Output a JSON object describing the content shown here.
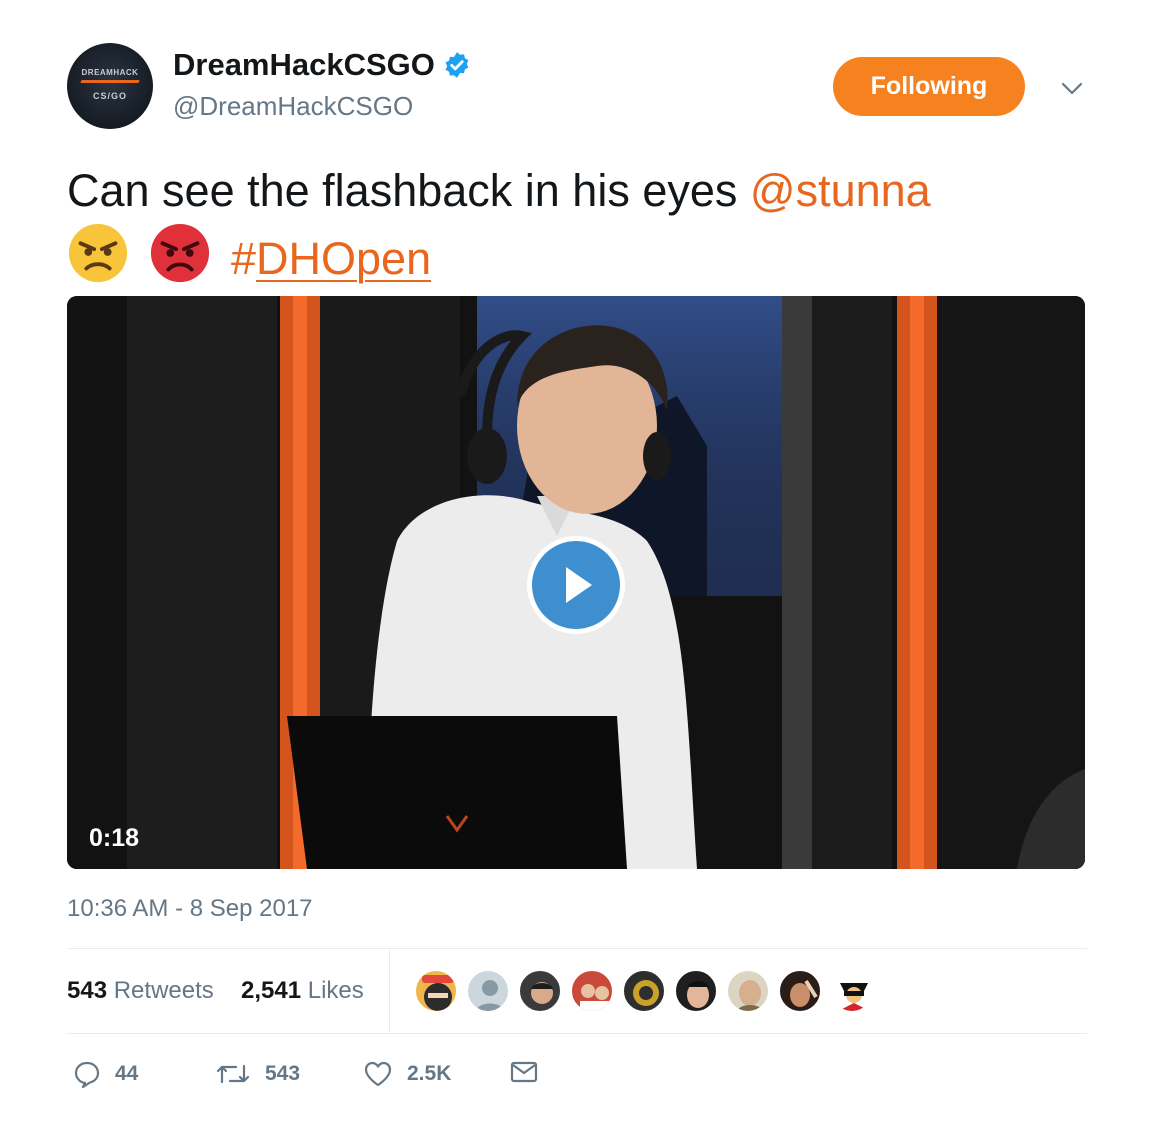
{
  "account": {
    "display_name": "DreamHackCSGO",
    "handle": "@DreamHackCSGO",
    "avatar_line1": "DREAMHACK",
    "avatar_line2": "CS/GO",
    "verified": true
  },
  "follow_button": {
    "label": "Following"
  },
  "tweet": {
    "text": "Can see the flashback in his eyes ",
    "mention": "@stunna",
    "emojis": [
      "angry-face",
      "pouting-face"
    ],
    "hashtag_symbol": "#",
    "hashtag": "DHOpen"
  },
  "video": {
    "duration": "0:18"
  },
  "timestamp": "10:36 AM - 8 Sep 2017",
  "stats": {
    "retweets_count": "543",
    "retweets_label": "Retweets",
    "likes_count": "2,541",
    "likes_label": "Likes"
  },
  "actions": {
    "reply_count": "44",
    "retweet_count": "543",
    "like_count": "2.5K"
  },
  "colors": {
    "accent": "#e8671f",
    "follow_button": "#f5821f",
    "play_button": "#3d8fcf",
    "verified": "#1da1f2",
    "muted_text": "#657786"
  }
}
